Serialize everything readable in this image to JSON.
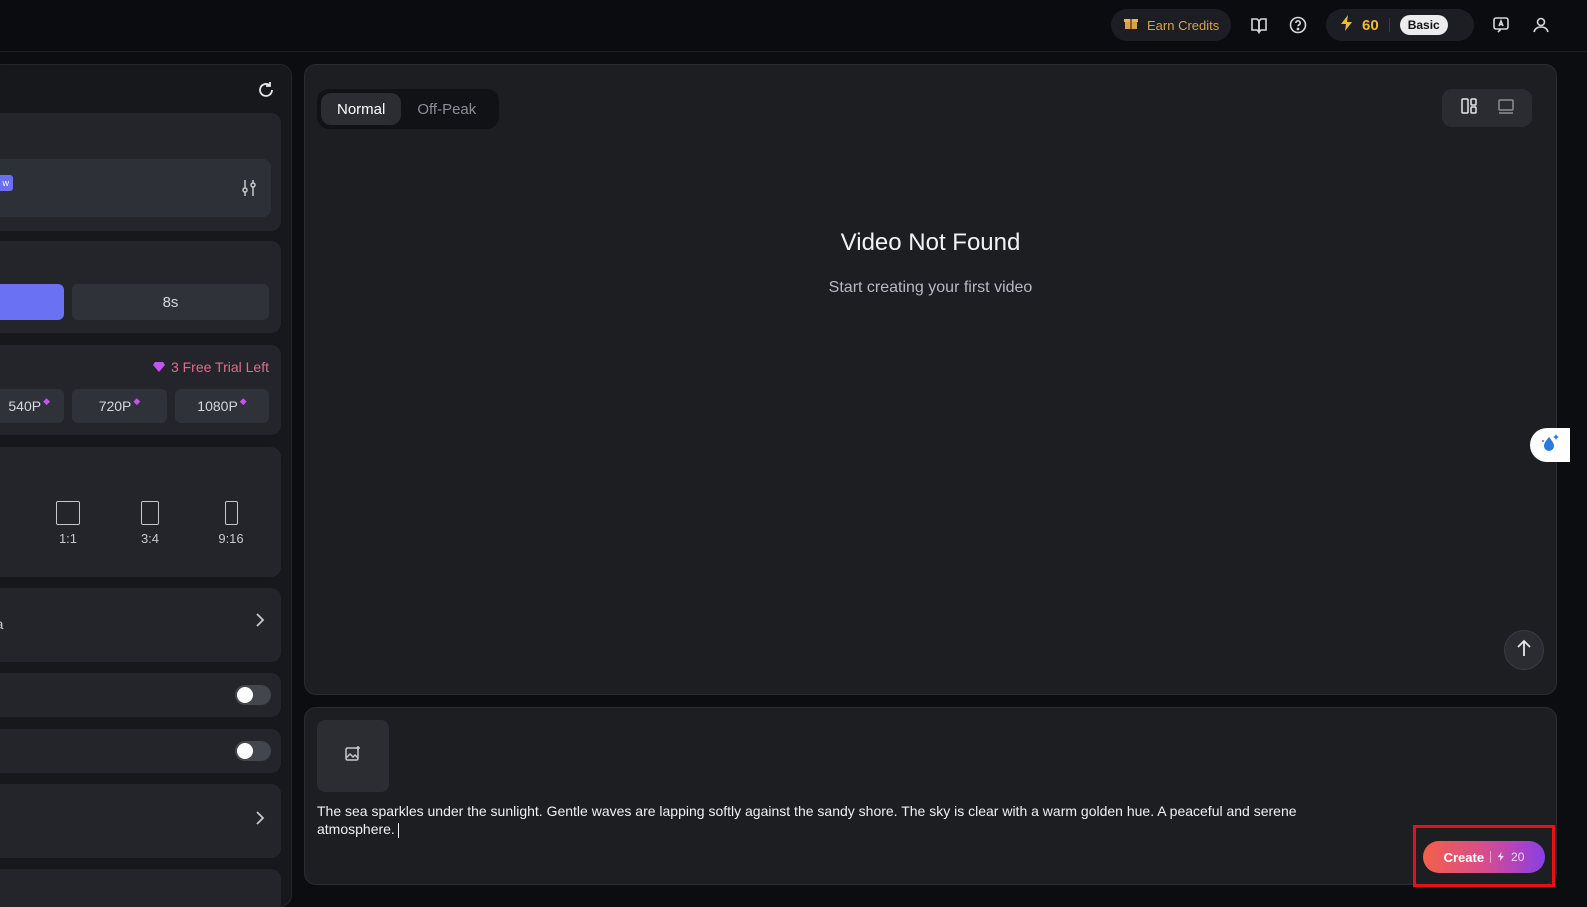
{
  "topbar": {
    "earn_credits": "Earn Credits",
    "credits": "60",
    "plan": "Basic"
  },
  "left": {
    "new_tag": "w",
    "duration_option": "8s",
    "trial": "3 Free Trial Left",
    "resolutions": [
      "540P",
      "720P",
      "1080P"
    ],
    "ratios": [
      "1:1",
      "3:4",
      "9:16"
    ],
    "camera_label": "ra"
  },
  "main": {
    "tabs": [
      {
        "label": "Normal",
        "active": true
      },
      {
        "label": "Off-Peak",
        "active": false
      }
    ],
    "empty_title": "Video Not Found",
    "empty_sub": "Start creating your first video"
  },
  "prompt": {
    "text": "The sea sparkles under the sunlight. Gentle waves are lapping softly against the sandy shore. The sky is clear with a warm golden hue. A peaceful and serene atmosphere.",
    "create_label": "Create",
    "create_cost": "20"
  },
  "colors": {
    "accent": "#6a72f3",
    "credit": "#f1b93c",
    "highlight": "#e4101a"
  }
}
